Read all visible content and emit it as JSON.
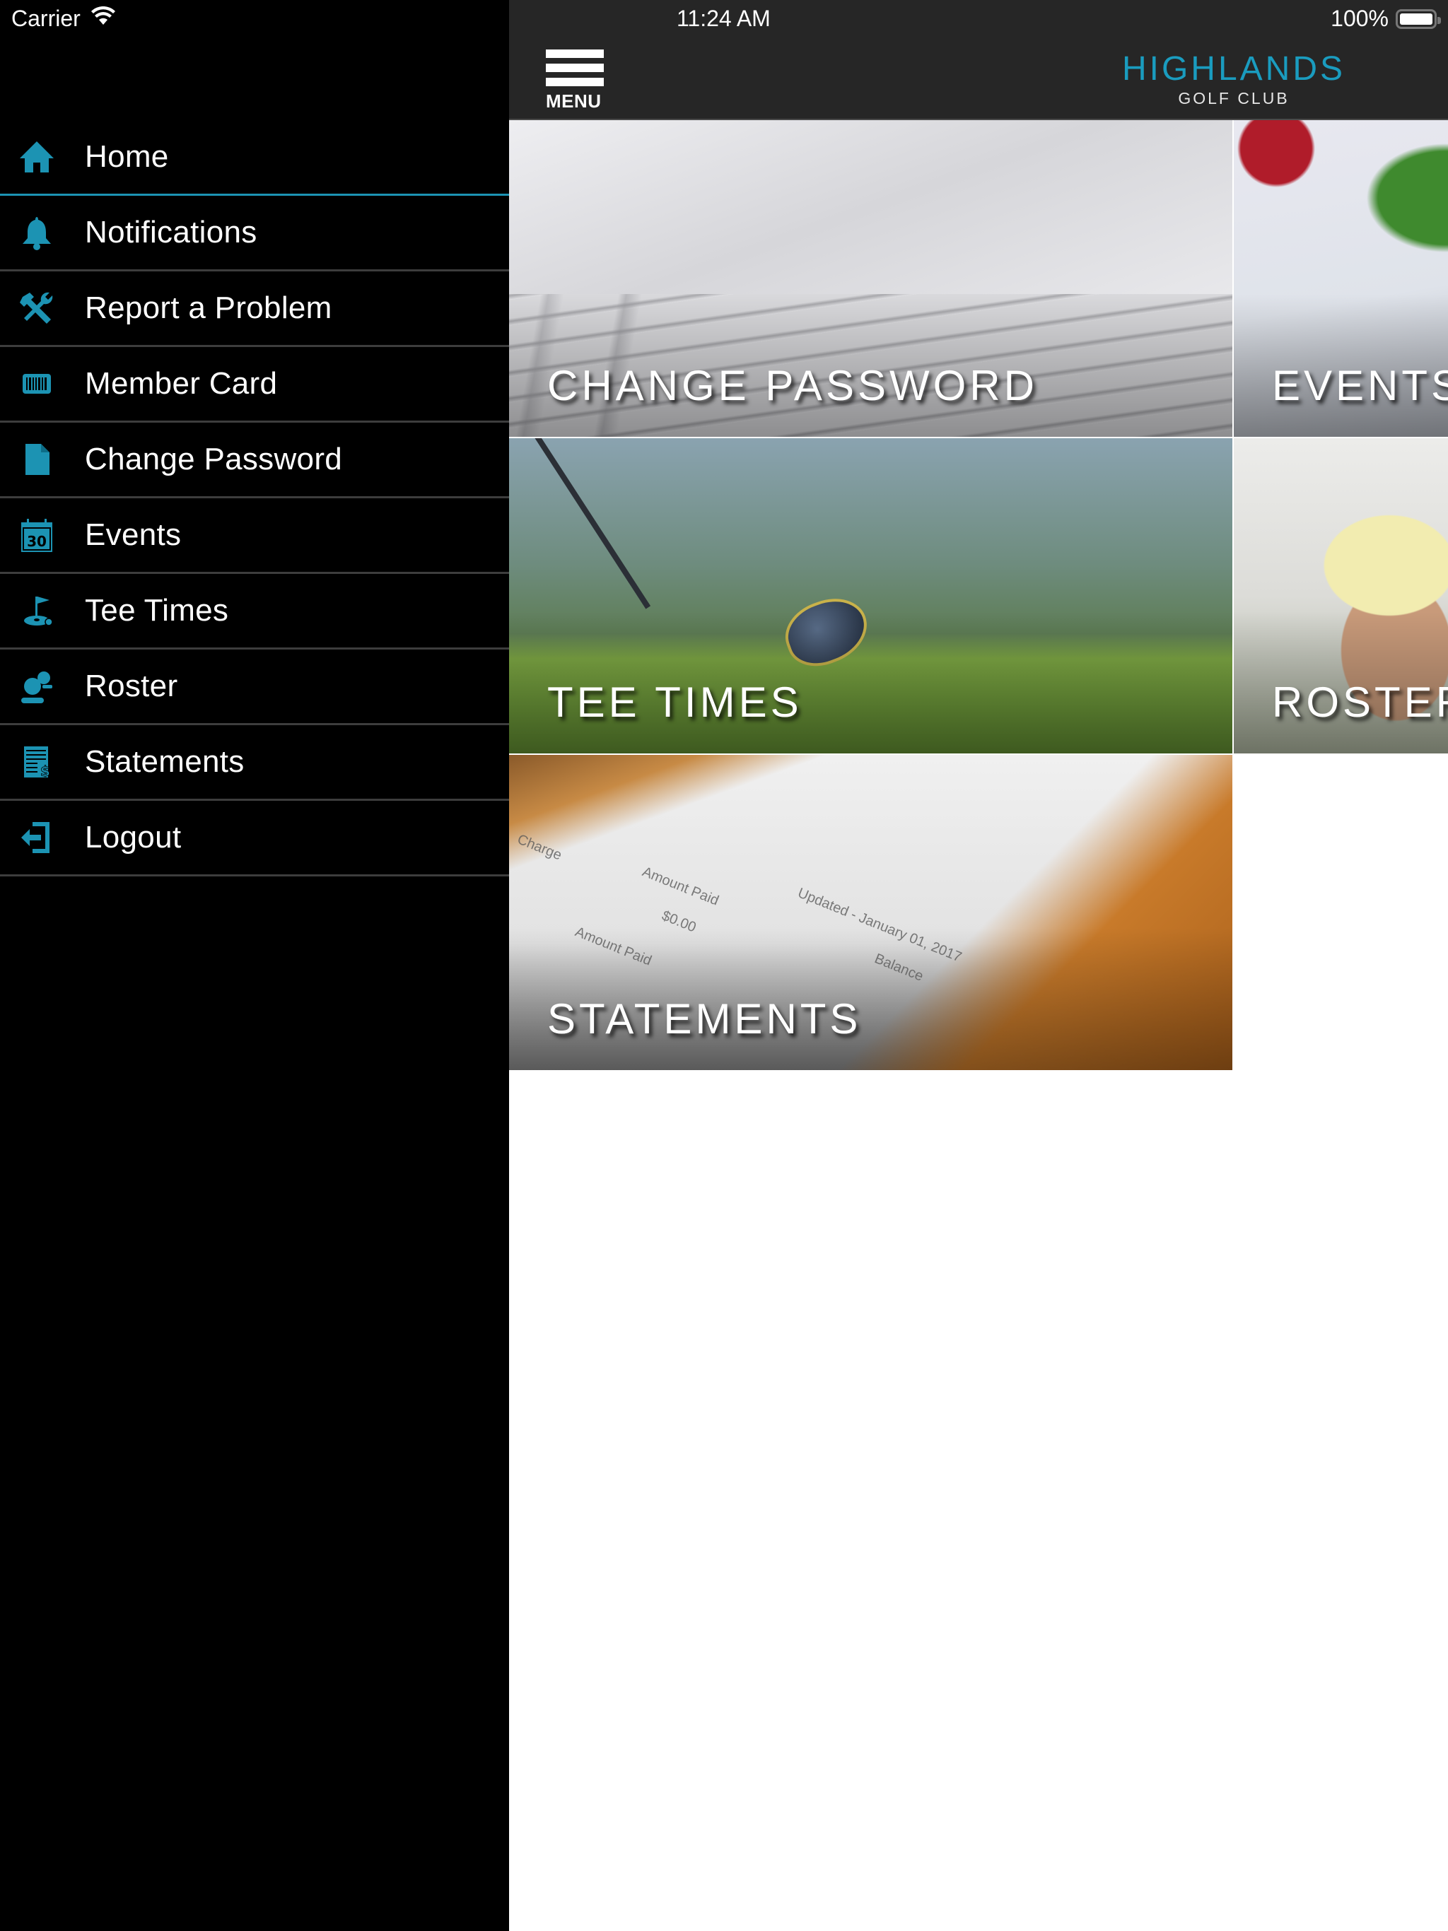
{
  "status_bar": {
    "carrier": "Carrier",
    "time": "11:24 AM",
    "battery_percent": "100%",
    "battery_level": 1.0
  },
  "sidebar": {
    "items": [
      {
        "label": "Home",
        "icon": "home-icon",
        "active": true
      },
      {
        "label": "Notifications",
        "icon": "bell-icon"
      },
      {
        "label": "Report a Problem",
        "icon": "tools-icon"
      },
      {
        "label": "Member Card",
        "icon": "barcode-card-icon"
      },
      {
        "label": "Change Password",
        "icon": "document-icon"
      },
      {
        "label": "Events",
        "icon": "calendar-icon",
        "calendar_day": "30"
      },
      {
        "label": "Tee Times",
        "icon": "golf-flag-icon"
      },
      {
        "label": "Roster",
        "icon": "people-icon"
      },
      {
        "label": "Statements",
        "icon": "statement-dollar-icon"
      },
      {
        "label": "Logout",
        "icon": "logout-icon"
      }
    ]
  },
  "header": {
    "menu_label": "MENU",
    "logo_main": "HIGHLANDS",
    "logo_sub": "GOLF CLUB"
  },
  "tiles": [
    {
      "label": "CHANGE PASSWORD"
    },
    {
      "label": "EVENTS"
    },
    {
      "label": "TEE TIMES"
    },
    {
      "label": "ROSTER"
    },
    {
      "label": "STATEMENTS",
      "photo_text": [
        "Charge",
        "Amount Paid",
        "$0.00",
        "Updated - January 01, 2017",
        "Amount Paid",
        "Balance"
      ]
    }
  ],
  "colors": {
    "accent": "#1c93b3",
    "logo": "#1a9cbf",
    "topbar": "#262626",
    "sidebar": "#000000",
    "separator": "#3d3d3d"
  }
}
